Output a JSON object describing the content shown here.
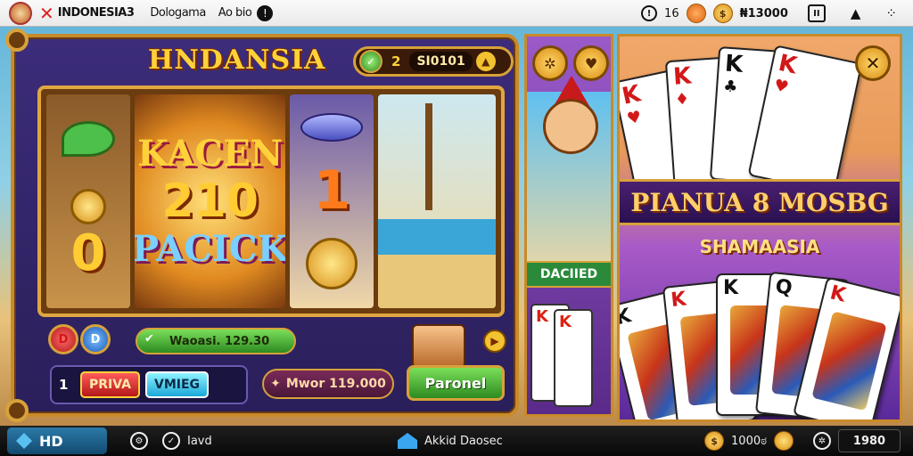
{
  "topbar": {
    "app_name": "INDONESIA3",
    "label_2": "Dologama",
    "label_3": "Ao bio",
    "info_symbol": "!",
    "clock_value": "16",
    "coin_value": "$",
    "balance_value": "₦13000",
    "grid_symbol": "⊞",
    "bell_symbol": "🔔",
    "menu_symbol": "⁘"
  },
  "slot": {
    "title": "HNDANSIA",
    "balance_count": "2",
    "balance_amount": "SI0101",
    "symbols": {
      "kacen": "KACEN",
      "amount_big": "210",
      "pacick": "PACICK",
      "one": "1",
      "zero": "0"
    },
    "chips": [
      "D",
      "D"
    ],
    "win_label": "Waoasi. 129.30",
    "bet_number": "1",
    "bet_red": "PRIVA",
    "bet_cyan": "VMIEG",
    "max_label": "Mwor 119.000",
    "play_button": "Paronel"
  },
  "middle": {
    "label": "DACIIED",
    "mini_card_1": "K",
    "mini_card_2": "K"
  },
  "cards": {
    "banner": "PIANUA 8 MOSBG",
    "subtitle": "SHAMAASIA",
    "close_symbol": "✕",
    "top_cards": [
      "K",
      "K",
      "K",
      "K"
    ],
    "court_cards": [
      "K",
      "K",
      "K",
      "Q",
      "K"
    ]
  },
  "bottombar": {
    "hd_label": "HD",
    "user_label": "Iavd",
    "center_label": "Akkid Daosec",
    "coins_label": "1000ಠ",
    "score": "1980"
  }
}
